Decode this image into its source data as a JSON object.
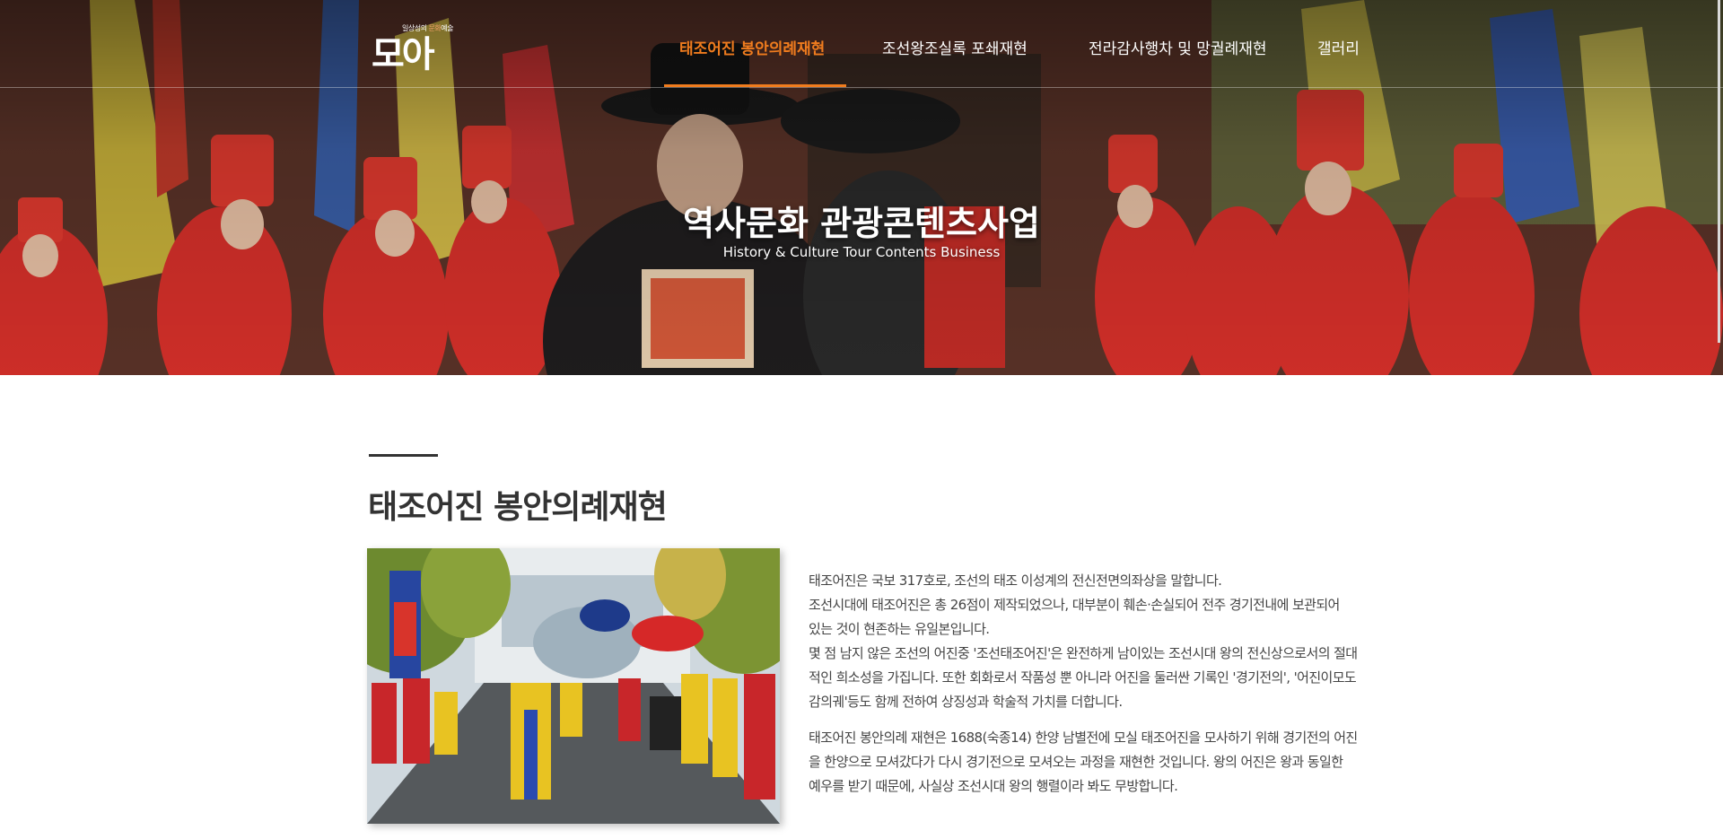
{
  "logo": {
    "tagline_before": "일상성의 ",
    "tagline_highlight": "문화",
    "tagline_after": "예술",
    "mark": "모아"
  },
  "nav": {
    "items": [
      {
        "label": "태조어진 봉안의례재현",
        "active": true
      },
      {
        "label": "조선왕조실록 포쇄재현",
        "active": false
      },
      {
        "label": "전라감사행차 및 망궐례재현",
        "active": false
      },
      {
        "label": "갤러리",
        "active": false
      }
    ],
    "accent_color": "#f07c1e"
  },
  "hero": {
    "title": "역사문화 관광콘텐츠사업",
    "subtitle": "History & Culture Tour Contents Business"
  },
  "section": {
    "title": "태조어진 봉안의례재현",
    "paragraph1": [
      "태조어진은 국보 317호로, 조선의 태조 이성계의 전신전면의좌상을 말합니다.",
      "조선시대에 태조어진은 총 26점이 제작되었으나, 대부분이 훼손·손실되어 전주 경기전내에 보관되어",
      "있는 것이 현존하는 유일본입니다.",
      "몇 점 남지 않은 조선의 어진중 '조선태조어진'은 완전하게 남이있는 조선시대 왕의 전신상으로서의 절대",
      "적인 희소성을 가집니다. 또한 회화로서 작품성 뿐 아니라 어진을 둘러싼 기록인 '경기전의', '어진이모도",
      "감의궤'등도 함께 전하여 상징성과 학술적 가치를 더합니다."
    ],
    "paragraph2": [
      "태조어진 봉안의례 재현은 1688(숙종14) 한양 남별전에 모실 태조어진을 모사하기 위해 경기전의 어진",
      "을 한양으로 모셔갔다가 다시 경기전으로 모셔오는 과정을 재현한 것입니다. 왕의 어진은 왕과 동일한",
      "예우를 받기 때문에, 사실상 조선시대 왕의 행렬이라 봐도 무방합니다."
    ]
  }
}
